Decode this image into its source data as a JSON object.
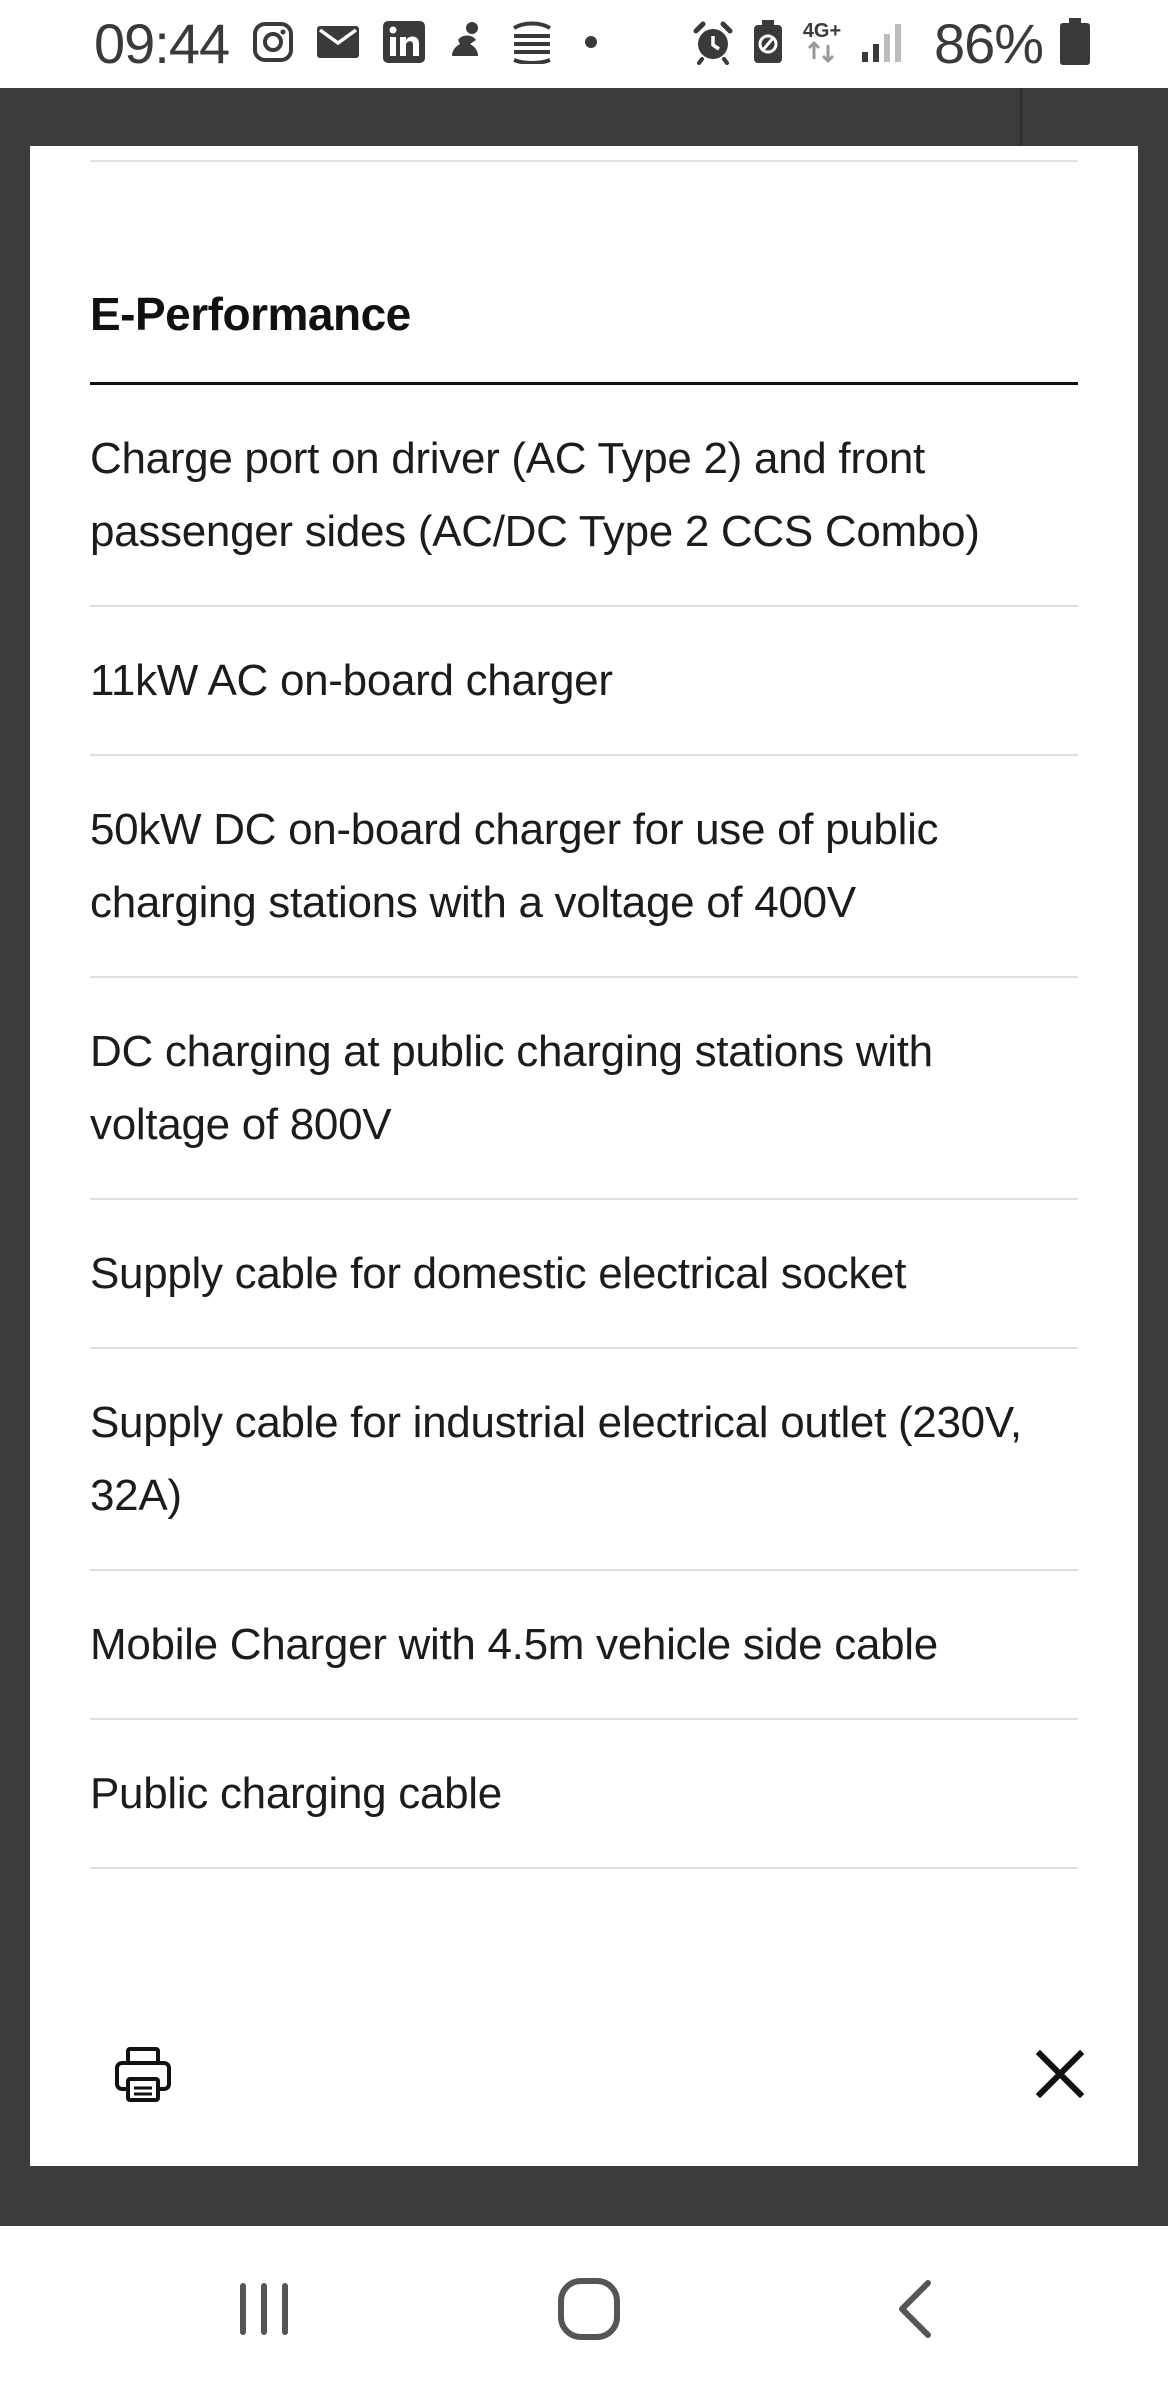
{
  "status_bar": {
    "time": "09:44",
    "network": "4G+",
    "battery_percent": "86%",
    "icons_left": [
      "instagram-icon",
      "mail-icon",
      "linkedin-icon",
      "app-icon",
      "stack-icon",
      "dot-icon"
    ],
    "icons_right": [
      "alarm-icon",
      "battery-saver-icon",
      "network-4g-icon",
      "signal-icon",
      "battery-icon"
    ]
  },
  "modal": {
    "section_title": "E-Performance",
    "features": [
      "Charge port on driver (AC Type 2) and front passenger sides (AC/DC Type 2 CCS Combo)",
      "11kW AC on-board charger",
      "50kW DC on-board charger for use of public charging stations with a voltage of 400V",
      "DC charging at public charging stations with voltage of 800V",
      "Supply cable for domestic electrical socket",
      "Supply cable for industrial electrical outlet (230V, 32A)",
      "Mobile Charger with 4.5m vehicle side cable",
      "Public charging cable"
    ],
    "print_icon": "printer-icon",
    "close_icon": "close-icon"
  },
  "nav_bar": {
    "buttons": [
      "recent-apps-icon",
      "home-icon",
      "back-icon"
    ]
  },
  "colors": {
    "overlay": "#3b3b3b",
    "title_rule": "#111111",
    "divider": "#dedede",
    "text": "#1c1c1c"
  }
}
